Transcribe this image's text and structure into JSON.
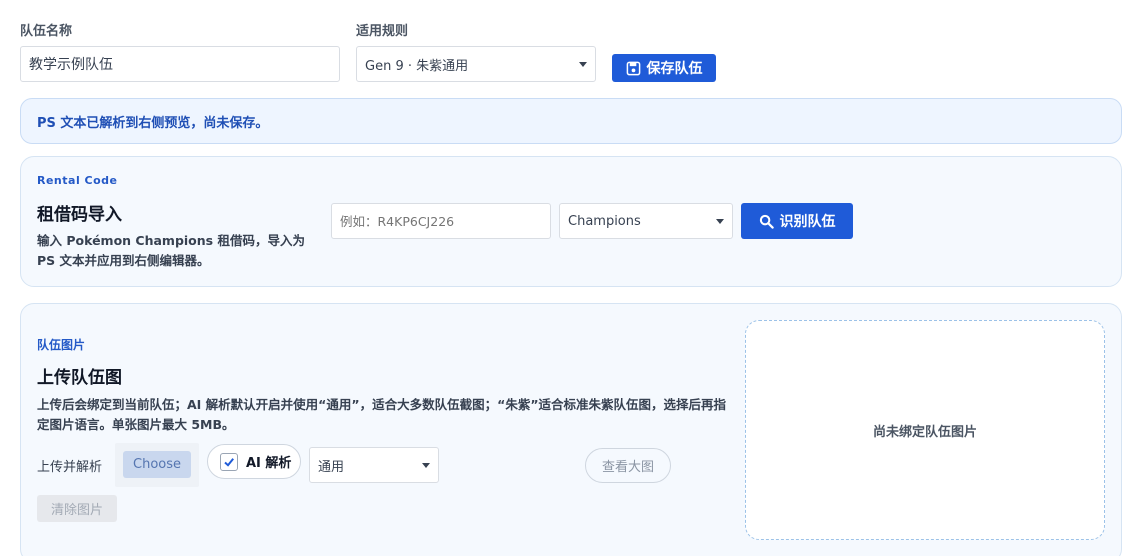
{
  "team_name": {
    "label": "队伍名称",
    "value": "教学示例队伍"
  },
  "rule": {
    "label": "适用规则",
    "selected": "Gen 9 · 朱紫通用"
  },
  "save_button": "保存队伍",
  "notice": "PS 文本已解析到右侧预览，尚未保存。",
  "rental": {
    "eyebrow": "Rental Code",
    "title": "租借码导入",
    "description": "输入 Pokémon Champions 租借码，导入为 PS 文本并应用到右侧编辑器。",
    "input_placeholder": "例如：R4KP6CJ226",
    "game_selected": "Champions",
    "identify_button": "识别队伍"
  },
  "image_upload": {
    "eyebrow": "队伍图片",
    "title": "上传队伍图",
    "description": "上传后会绑定到当前队伍；AI 解析默认开启并使用“通用”，适合大多数队伍截图；“朱紫”适合标准朱紫队伍图，选择后再指定图片语言。单张图片最大 5MB。",
    "upload_label": "上传并解析",
    "choose_button": "Choose",
    "ai_parse_label": "AI 解析",
    "ai_parse_checked": true,
    "mode_selected": "通用",
    "view_large_button": "查看大图",
    "clear_button": "清除图片",
    "empty_preview": "尚未绑定队伍图片"
  },
  "colors": {
    "accent": "#1f5bd8",
    "card_bg": "#f5f9fe",
    "notice_bg": "#eef5ff"
  }
}
